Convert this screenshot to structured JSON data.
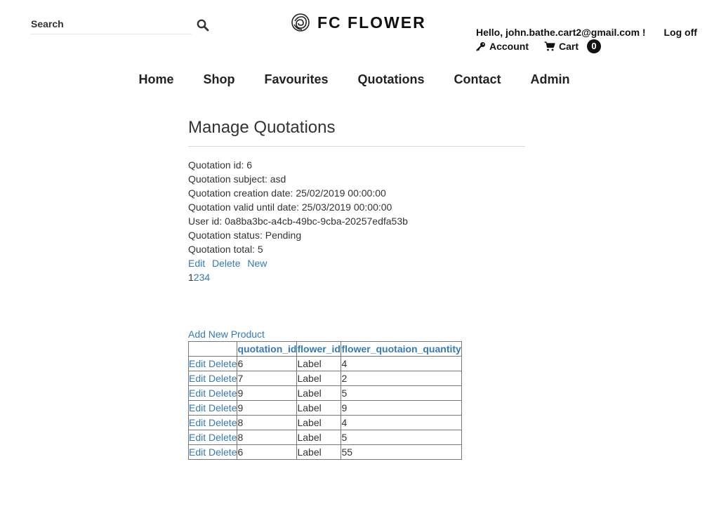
{
  "search": {
    "placeholder": "Search"
  },
  "brand": {
    "name": "FC FLOWER"
  },
  "user": {
    "greeting": "Hello, john.bathe.cart2@gmail.com !",
    "logoff": "Log off",
    "account": "Account",
    "cart": "Cart",
    "cart_count": "0"
  },
  "nav": [
    "Home",
    "Shop",
    "Favourites",
    "Quotations",
    "Contact",
    "Admin"
  ],
  "page": {
    "title": "Manage Quotations"
  },
  "quotation": {
    "id": "Quotation id: 6",
    "subject": "Quotation subject: asd",
    "created": "Quotation creation date: 25/02/2019 00:00:00",
    "valid_until": "Quotation valid until date: 25/03/2019 00:00:00",
    "user_id": "User id: 0a8ba3bc-a4cb-49bc-9cba-20257edfa53b",
    "status": "Quotation status: Pending",
    "total": "Quotation total: 5"
  },
  "actions": {
    "edit": "Edit",
    "delete": "Delete",
    "new": "New"
  },
  "pager": {
    "current": "1",
    "pages": [
      "2",
      "3",
      "4"
    ]
  },
  "products": {
    "add_label": "Add New Product",
    "headers": [
      "",
      "quotation_id",
      "flower_id",
      "flower_quotaion_quantity"
    ],
    "edit_label": "Edit",
    "delete_label": "Delete",
    "rows": [
      {
        "quotation_id": "6",
        "flower_id": "Label",
        "quantity": "4"
      },
      {
        "quotation_id": "7",
        "flower_id": "Label",
        "quantity": "2"
      },
      {
        "quotation_id": "9",
        "flower_id": "Label",
        "quantity": "5"
      },
      {
        "quotation_id": "9",
        "flower_id": "Label",
        "quantity": "9"
      },
      {
        "quotation_id": "8",
        "flower_id": "Label",
        "quantity": "4"
      },
      {
        "quotation_id": "8",
        "flower_id": "Label",
        "quantity": "5"
      },
      {
        "quotation_id": "6",
        "flower_id": "Label",
        "quantity": "55"
      }
    ]
  },
  "colors": {
    "link": "#337ab7",
    "text": "#333333",
    "badge": "#111111"
  },
  "icons": {
    "search": "search-icon",
    "logo": "rose-logo-icon",
    "account": "key-icon",
    "cart": "cart-icon"
  }
}
